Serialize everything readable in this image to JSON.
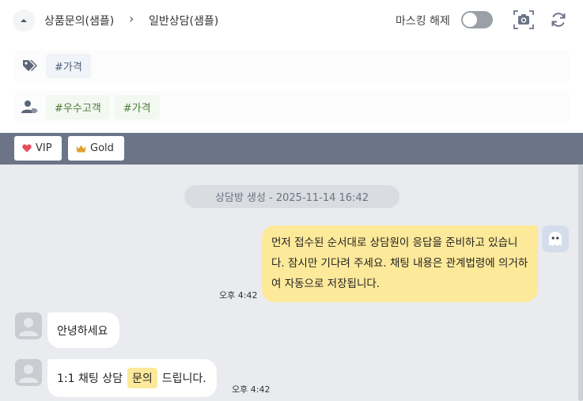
{
  "header": {
    "breadcrumb_1": "상품문의(샘플)",
    "breadcrumb_sep": "›",
    "breadcrumb_2": "일반상담(샘플)",
    "masking_label": "마스킹 해제",
    "masking_enabled": false
  },
  "tags": {
    "row1": [
      "#가격"
    ],
    "row2": [
      "#우수고객",
      "#가격"
    ]
  },
  "grades": {
    "vip_label": "VIP",
    "gold_label": "Gold"
  },
  "chat": {
    "system_message": "상담방 생성 - 2025-11-14 16:42",
    "bot_message": "먼저 접수된 순서대로 상담원이 응답을 준비하고 있습니다. 잠시만 기다려 주세요. 채팅 내용은 관계법령에 의거하여 자동으로 저장됩니다.",
    "bot_time": "오후 4:42",
    "user_message_1": "안녕하세요",
    "user_message_2_pre": "1:1 채팅 상담",
    "user_message_2_highlight": "문의",
    "user_message_2_post": "드립니다.",
    "user_time_2": "오후 4:42"
  },
  "colors": {
    "grade_bar": "#6b7587",
    "chat_bg": "#e9ebee",
    "bot_bubble": "#fde99a",
    "heart": "#e74c5b",
    "crown": "#e0a030"
  },
  "icons": {
    "collapse": "chevron-up-icon",
    "camera": "camera-icon",
    "refresh": "refresh-icon",
    "tag": "tag-icon",
    "customer": "user-tag-icon",
    "heart": "heart-icon",
    "crown": "crown-icon",
    "bot": "bot-ghost-icon",
    "user": "user-avatar-icon"
  }
}
